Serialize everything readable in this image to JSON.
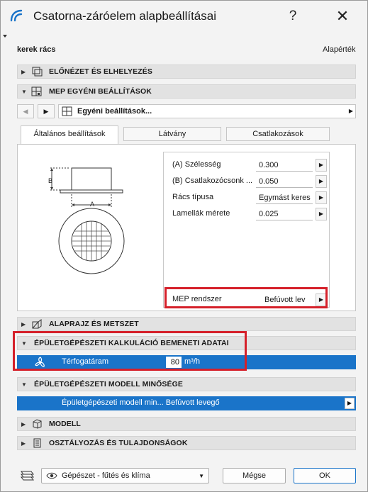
{
  "window": {
    "title": "Csatorna-záróelem alapbeállításai",
    "help_label": "?",
    "close_label": "✕"
  },
  "selection": {
    "name": "kerek rács",
    "default_label": "Alapérték"
  },
  "panels": {
    "preview": "ELŐNÉZET ÉS ELHELYEZÉS",
    "mep_custom": "MEP EGYÉNI BEÁLLÍTÁSOK",
    "plan_section": "ALAPRAJZ ÉS METSZET",
    "calc_input": "ÉPÜLETGÉPÉSZETI KALKULÁCIÓ BEMENETI ADATAI",
    "model_quality": "ÉPÜLETGÉPÉSZETI MODELL MINŐSÉGE",
    "model": "MODELL",
    "classification": "OSZTÁLYOZÁS ÉS TULAJDONSÁGOK"
  },
  "nav": {
    "prev": "◀",
    "next": "▶",
    "selected": "Egyéni beállítások...",
    "caret": "▶"
  },
  "tabs": [
    {
      "label": "Általános beállítások",
      "active": true
    },
    {
      "label": "Látvány",
      "active": false
    },
    {
      "label": "Csatlakozások",
      "active": false
    }
  ],
  "diagram": {
    "label_a": "A",
    "label_b": "B"
  },
  "params": [
    {
      "label": "(A) Szélesség",
      "value": "0.300"
    },
    {
      "label": "(B) Csatlakozócsonk ...",
      "value": "0.050"
    },
    {
      "label": "Rács típusa",
      "value": "Egymást keres"
    },
    {
      "label": "Lamellák mérete",
      "value": "0.025"
    }
  ],
  "mep_system": {
    "label": "MEP rendszer",
    "value": "Befúvott lev"
  },
  "calc": {
    "label": "Térfogatáram",
    "value": "80",
    "unit": "m³/h"
  },
  "model_quality_row": {
    "text": "Épületgépészeti modell min... Befúvott levegő"
  },
  "footer": {
    "layer": "Gépészet - fűtés és klíma",
    "cancel": "Mégse",
    "ok": "OK"
  },
  "colors": {
    "accent": "#1a74c9",
    "highlight_border": "#d5202a"
  }
}
